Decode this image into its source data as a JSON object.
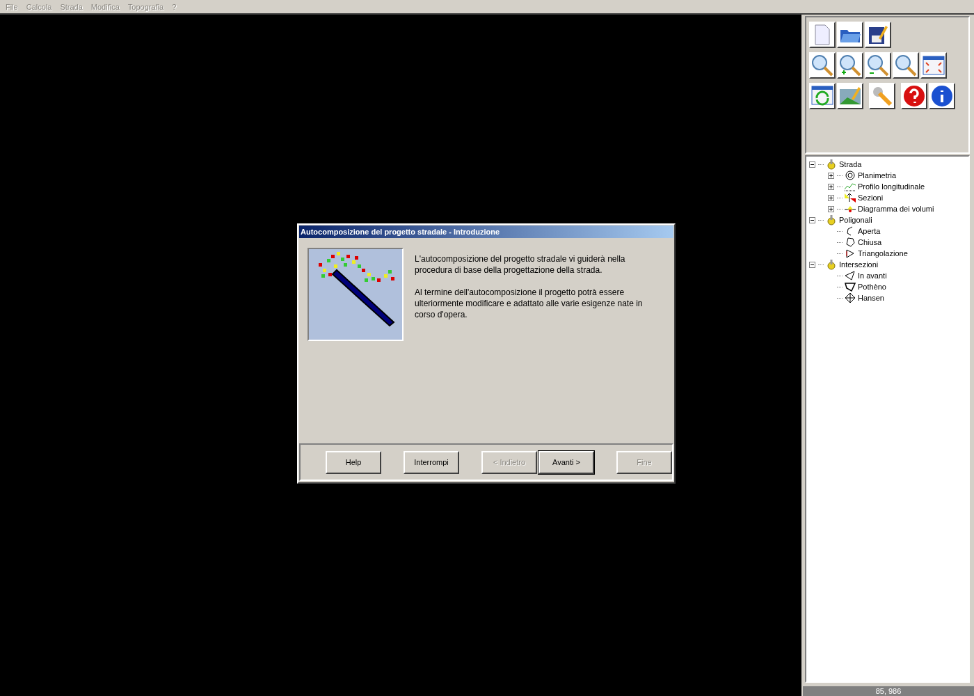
{
  "menu": [
    {
      "label": "File",
      "disabled": true
    },
    {
      "label": "Calcola",
      "disabled": true
    },
    {
      "label": "Strada",
      "disabled": true
    },
    {
      "label": "Modifica",
      "disabled": true
    },
    {
      "label": "Topografia",
      "disabled": true
    },
    {
      "label": "?",
      "disabled": true
    }
  ],
  "dialog": {
    "title": "Autocomposizione del progetto stradale - Introduzione",
    "paragraphs": [
      "L'autocomposizione del progetto stradale vi guiderà nella procedura di base della progettazione della strada.",
      " Al termine dell'autocomposizione il progetto potrà essere ulteriormente modificare e adattato alle varie esigenze nate in corso d'opera."
    ],
    "buttons": [
      {
        "label": "Help",
        "disabled": false,
        "default": false
      },
      {
        "label": "Interrompi",
        "disabled": false,
        "default": false
      },
      {
        "label": "< Indietro",
        "disabled": true,
        "default": false
      },
      {
        "label": "Avanti >",
        "disabled": false,
        "default": true
      },
      {
        "label": "Fine",
        "disabled": true,
        "default": false
      }
    ]
  },
  "tree": [
    {
      "label": "Strada",
      "kind": "group",
      "expanded": true,
      "children": [
        {
          "label": "Planimetria",
          "kind": "plan",
          "expanded": false
        },
        {
          "label": "Profilo longitudinale",
          "kind": "profile",
          "expanded": false
        },
        {
          "label": "Sezioni",
          "kind": "section",
          "expanded": false
        },
        {
          "label": "Diagramma dei volumi",
          "kind": "volume",
          "expanded": false
        }
      ]
    },
    {
      "label": "Poligonali",
      "kind": "group",
      "expanded": true,
      "children": [
        {
          "label": "Aperta",
          "kind": "open"
        },
        {
          "label": "Chiusa",
          "kind": "closed"
        },
        {
          "label": "Triangolazione",
          "kind": "triangle"
        }
      ]
    },
    {
      "label": "Intersezioni",
      "kind": "group",
      "expanded": true,
      "children": [
        {
          "label": "In avanti",
          "kind": "forward"
        },
        {
          "label": "Pothèno",
          "kind": "pothenot"
        },
        {
          "label": "Hansen",
          "kind": "hansen"
        }
      ]
    }
  ],
  "status": "85, 986"
}
